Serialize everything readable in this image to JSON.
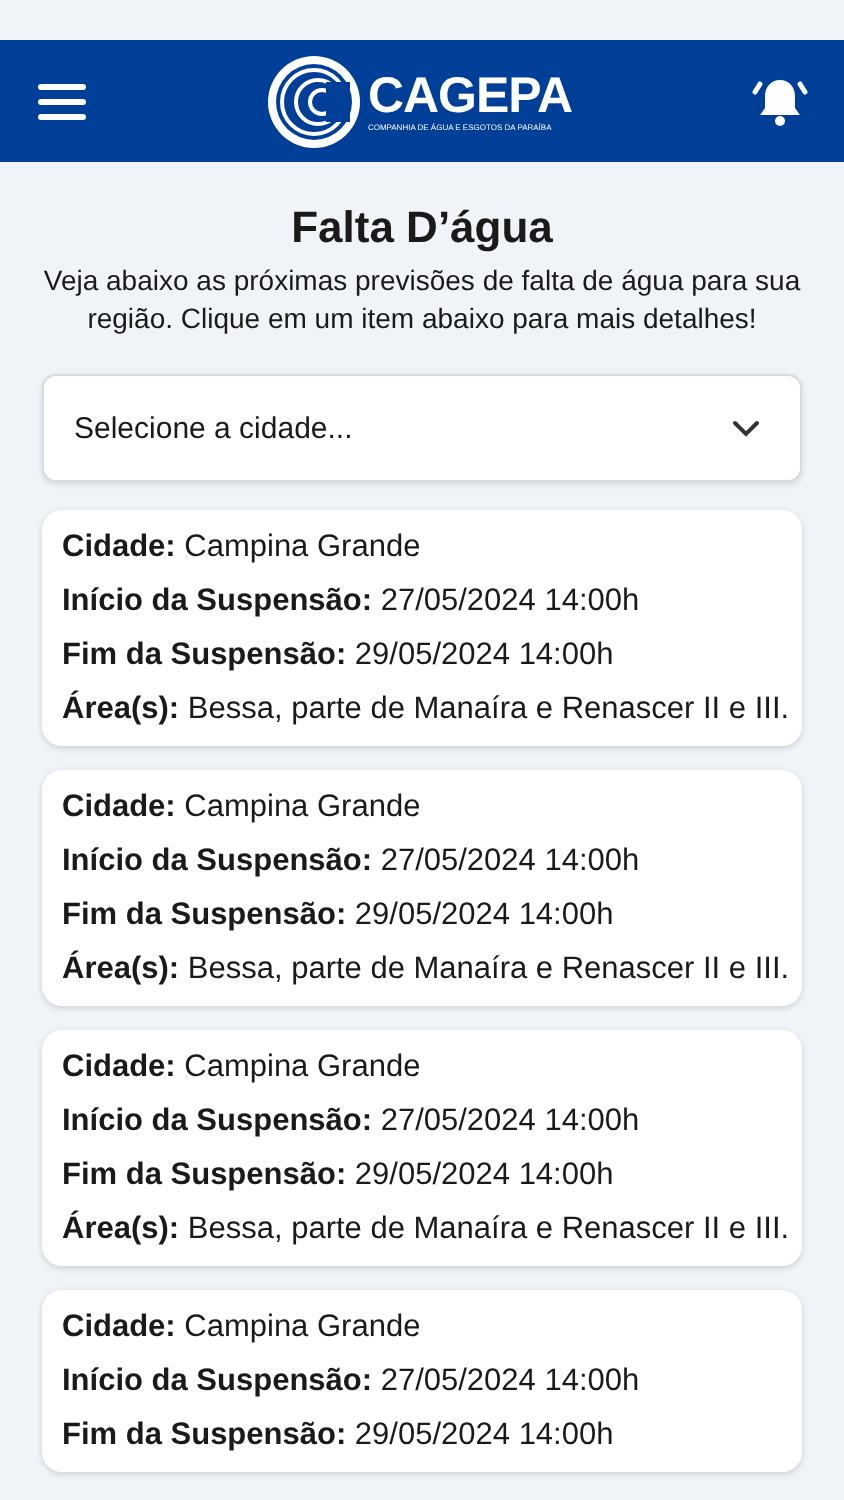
{
  "header": {
    "logo_name": "CAGEPA",
    "logo_subtitle": "COMPANHIA DE ÁGUA E ESGOTOS DA PARAÍBA"
  },
  "title": "Falta D’água",
  "description": "Veja abaixo as próximas previsões de falta de água para sua região. Clique em um item abaixo para mais detalhes!",
  "city_select": {
    "placeholder": "Selecione a cidade..."
  },
  "notices": [
    {
      "lines": [
        "**Cidade:** Campina Grande",
        "**Início da Suspensão:** 27/05/2024 14:00h",
        "**Fim da Suspensão:** 29/05/2024 14:00h",
        "**Área(s):** Bessa, parte de Manaíra e Renascer II e III."
      ]
    },
    {
      "lines": [
        "**Cidade:** Campina Grande",
        "**Início da Suspensão:** 27/05/2024 14:00h",
        "**Fim da Suspensão:** 29/05/2024 14:00h",
        "**Área(s):** Bessa, parte de Manaíra e Renascer II e III."
      ]
    },
    {
      "lines": [
        "**Cidade:** Campina Grande",
        "**Início da Suspensão:** 27/05/2024 14:00h",
        "**Fim da Suspensão:** 29/05/2024 14:00h",
        "**Área(s):** Bessa, parte de Manaíra e Renascer II e III."
      ]
    },
    {
      "lines": [
        "**Cidade:** Campina Grande",
        "**Início da Suspensão:** 27/05/2024 14:00h",
        "**Fim da Suspensão:** 29/05/2024 14:00h"
      ]
    }
  ]
}
